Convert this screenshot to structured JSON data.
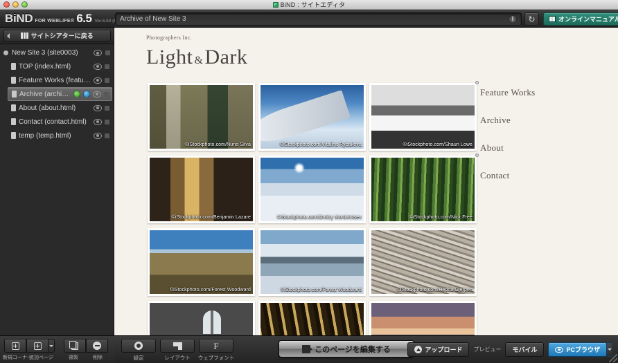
{
  "os": {
    "window_title": "BiND : サイトエディタ",
    "app_icon": "bind-app-icon"
  },
  "header": {
    "logo_name": "BiND",
    "logo_tagline": "FOR WEBLIFE®",
    "logo_version_num": "6.5",
    "logo_build": "Ver.6.50 (b1163)",
    "url_value": "Archive of New Site 3",
    "url_placeholder": "Archive of New Site 3",
    "info_badge": "i",
    "refresh_icon": "↻",
    "manual_button": "オンラインマニュアル"
  },
  "sidebar": {
    "back_button": "サイトシアターに戻る",
    "site_root": "New Site 3 (site0003)",
    "pages": [
      {
        "label": "TOP (index.html)",
        "selected": false,
        "badges": []
      },
      {
        "label": "Feature Works (feature-work...",
        "selected": false,
        "badges": []
      },
      {
        "label": "Archive (archive.html)",
        "selected": true,
        "badges": [
          "green",
          "blue"
        ]
      },
      {
        "label": "About (about.html)",
        "selected": false,
        "badges": []
      },
      {
        "label": "Contact (contact.html)",
        "selected": false,
        "badges": []
      },
      {
        "label": "temp (temp.html)",
        "selected": false,
        "badges": []
      }
    ],
    "tools": [
      {
        "caption": "新規コーナー",
        "icon": "plus-box-icon"
      },
      {
        "caption": "追加ページ",
        "icon": "plus-box-icon"
      },
      {
        "caption": "複製",
        "icon": "duplicate-icon"
      },
      {
        "caption": "削除",
        "icon": "minus-circle-icon"
      }
    ]
  },
  "canvas": {
    "brand": "Photographers Inc.",
    "title_first": "Light",
    "title_amp": "&",
    "title_second": "Dark",
    "nav": [
      {
        "label": "Feature Works"
      },
      {
        "label": "Archive"
      },
      {
        "label": "About"
      },
      {
        "label": "Contact"
      }
    ],
    "gallery": [
      {
        "caption": "©iStockphoto.com/Nuno Silva",
        "art": "art-door",
        "alt": "weathered-building-green-door"
      },
      {
        "caption": "©iStockphoto.com/Vitalina Rybakova",
        "art": "art-wing",
        "alt": "airplane-wing-above-clouds"
      },
      {
        "caption": "©iStockphoto.com/Shaun Lowe",
        "art": "art-coast",
        "alt": "monochrome-coastline"
      },
      {
        "caption": "©iStockphoto.com/Benjamin Lazare",
        "art": "art-alley",
        "alt": "narrow-european-alley"
      },
      {
        "caption": "©iStockphoto.com/Dmitry Mordvintsev",
        "art": "art-snow",
        "alt": "snow-field-with-sun"
      },
      {
        "caption": "©iStockphoto.com/Nick Free",
        "art": "art-bamboo",
        "alt": "bamboo-forest"
      },
      {
        "caption": "©iStockphoto.com/Forest Woodward",
        "art": "art-cliff",
        "alt": "cliff-with-stone-bridge"
      },
      {
        "caption": "©iStockphoto.com/Forest Woodward",
        "art": "art-lake",
        "alt": "lake-with-wooden-pier"
      },
      {
        "caption": "©iStockphoto.com/Hedda Gjerpen",
        "art": "art-mud",
        "alt": "cracked-mud-flats"
      },
      {
        "caption": "",
        "art": "art-church",
        "alt": "church-interior-stained-glass"
      },
      {
        "caption": "",
        "art": "art-rays",
        "alt": "sun-rays-through-forest"
      },
      {
        "caption": "",
        "art": "art-dusk",
        "alt": "lake-at-dusk"
      }
    ]
  },
  "bottombar": {
    "tools": [
      {
        "caption": "設定",
        "icon": "gear-icon"
      },
      {
        "caption": "レイアウト",
        "icon": "layout-icon"
      },
      {
        "caption": "ウェブフォント",
        "icon": "webfont-f-icon"
      }
    ],
    "edit_button": "このページを編集する",
    "upload_button": "アップロード",
    "preview_label": "プレビュー",
    "mobile_button": "モバイル",
    "pc_button": "PCブラウザ"
  },
  "colors": {
    "accent_teal": "#1d6b5b",
    "accent_blue": "#1f78b8",
    "canvas_bg": "#f5f2eb",
    "chrome_dark": "#2a2a2a",
    "badge_green": "#3f9c2c",
    "badge_blue": "#1f7fc4"
  }
}
